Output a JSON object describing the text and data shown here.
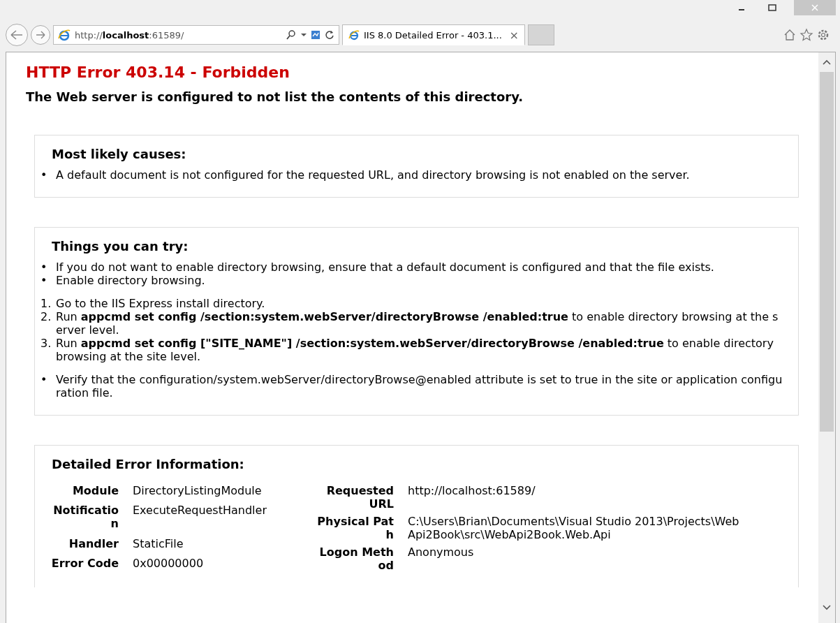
{
  "browser": {
    "address": "http://**localhost**:61589/",
    "tabs": [
      {
        "title": "IIS 8.0 Detailed Error - 403.1...",
        "close": "×",
        "selected": true
      }
    ]
  },
  "page": {
    "error_title": "HTTP Error 403.14 - Forbidden",
    "error_subtitle": "The Web server is configured to not list the contents of this directory.",
    "causes": {
      "heading": "Most likely causes:",
      "items": [
        {
          "bullet": "•",
          "text": "A default document is not configured for the requested URL, and directory browsing is not enabled on the server."
        }
      ]
    },
    "try": {
      "heading": "Things you can try:",
      "bullets": [
        {
          "bullet": "•",
          "text": "If you do not want to enable directory browsing, ensure that a default document is configured and that the file exists."
        },
        {
          "bullet": "•",
          "text": "Enable directory browsing."
        }
      ],
      "steps": [
        {
          "number": "1.",
          "text": "Go to the IIS Express install directory."
        },
        {
          "number": "2.",
          "text": "Run **appcmd set config /section:system.webServer/directoryBrowse /enabled:true** to enable directory browsing at the server level."
        },
        {
          "number": "3.",
          "text": "Run **appcmd set config [\"SITE_NAME\"] /section:system.webServer/directoryBrowse /enabled:true** to enable directory browsing at the site level."
        }
      ],
      "bullets_after": [
        {
          "bullet": "•",
          "text": "Verify that the configuration/system.webServer/directoryBrowse@enabled attribute is set to true in the site or application configuration file."
        }
      ]
    },
    "details": {
      "heading": "Detailed Error Information:",
      "left": [
        {
          "label": "Module",
          "value": "DirectoryListingModule"
        },
        {
          "label": "Notification",
          "value": "ExecuteRequestHandler"
        },
        {
          "label": "Handler",
          "value": "StaticFile"
        },
        {
          "label": "Error Code",
          "value": "0x00000000"
        }
      ],
      "right": [
        {
          "label": "Requested URL",
          "value": "http://localhost:61589/"
        },
        {
          "label": "Physical Path",
          "value": "C:\\Users\\Brian\\Documents\\Visual Studio 2013\\Projects\\WebApi2Book\\src\\WebApi2Book.Web.Api"
        },
        {
          "label": "Logon Method",
          "value": "Anonymous"
        }
      ]
    }
  }
}
